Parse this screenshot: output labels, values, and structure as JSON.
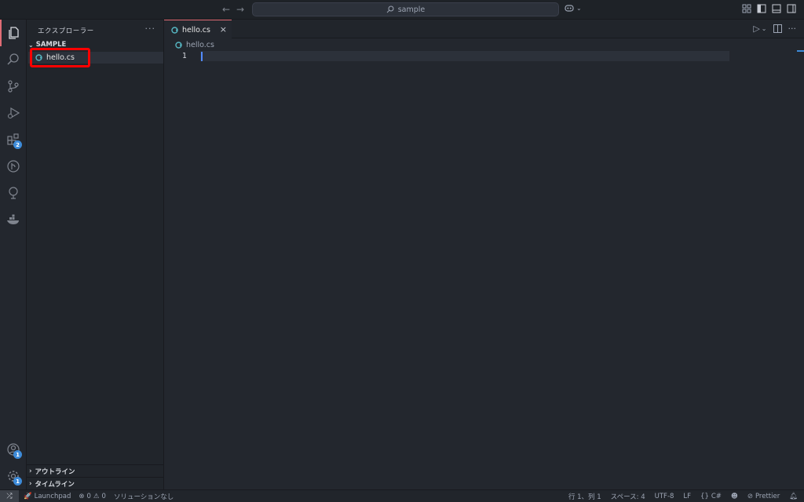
{
  "titlebar": {
    "search_text": "sample"
  },
  "activitybar": {
    "extensions_badge": "2",
    "accounts_badge": "1",
    "manage_badge": "1"
  },
  "sidebar": {
    "title": "エクスプローラー",
    "more": "···",
    "folder": "SAMPLE",
    "files": [
      {
        "name": "hello.cs",
        "icon": "csharp-icon"
      }
    ],
    "sections": [
      {
        "label": "アウトライン"
      },
      {
        "label": "タイムライン"
      }
    ]
  },
  "editor": {
    "tabs": [
      {
        "label": "hello.cs",
        "active": true
      }
    ],
    "breadcrumb": "hello.cs",
    "line_number": "1"
  },
  "statusbar": {
    "launchpad": "Launchpad",
    "errors": "0",
    "warnings": "0",
    "solution": "ソリューションなし",
    "position": "行 1、列 1",
    "spaces": "スペース: 4",
    "encoding": "UTF-8",
    "eol": "LF",
    "language": "C#",
    "prettier": "Prettier"
  },
  "colors": {
    "accent": "#e06c75",
    "badge": "#3d8bd9",
    "csharp": "#56b6c2",
    "highlight_box": "#ff0000"
  }
}
